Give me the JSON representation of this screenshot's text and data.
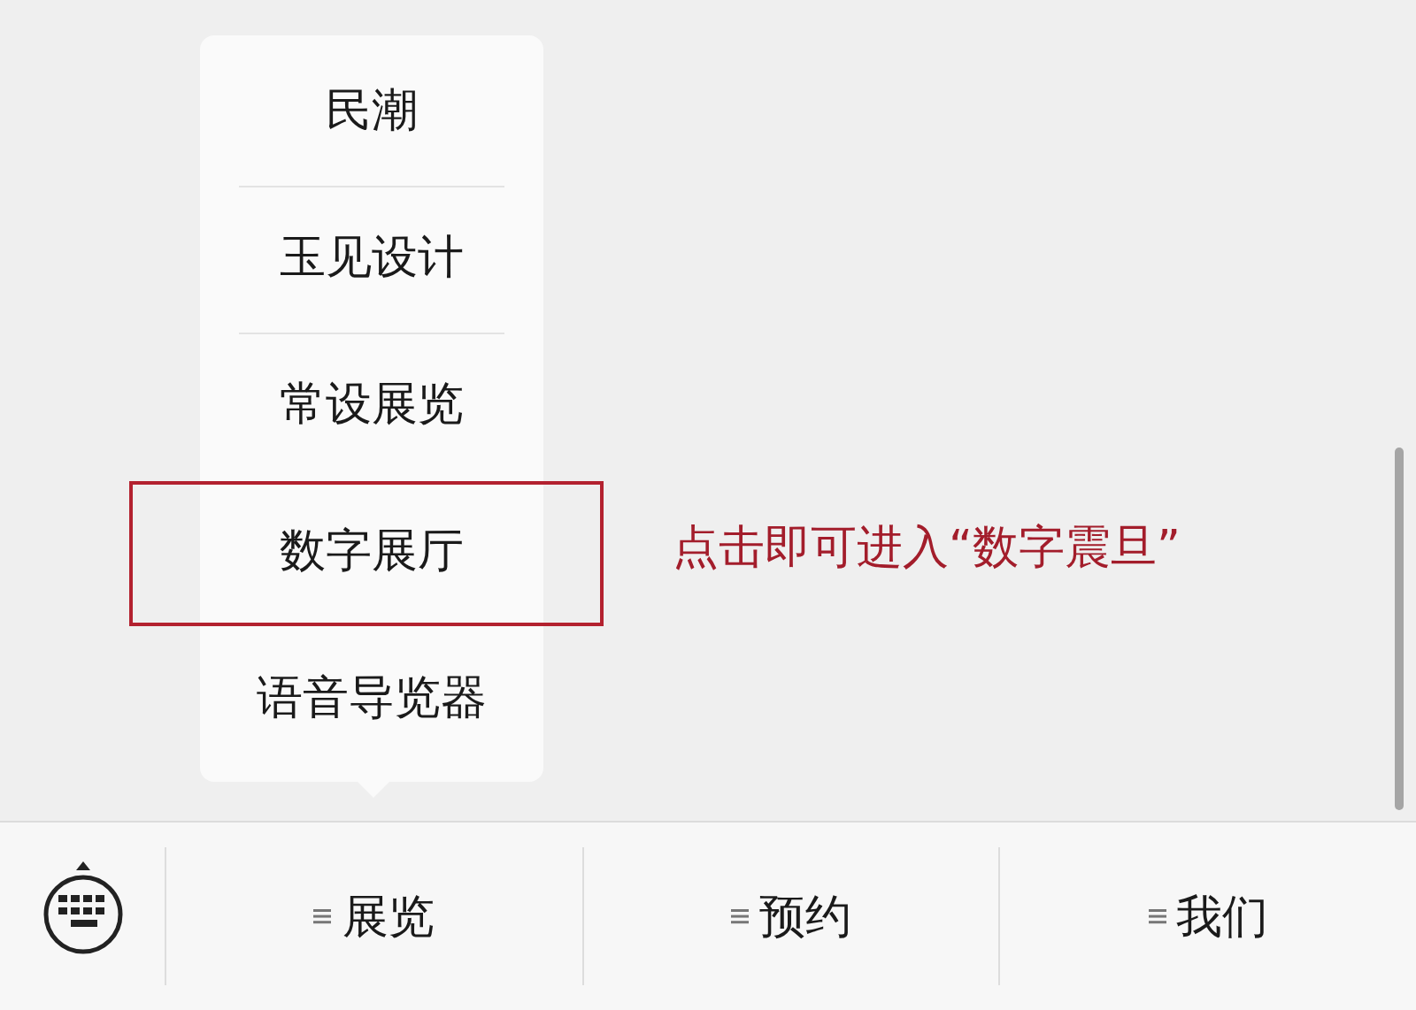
{
  "submenu": {
    "items": [
      {
        "label": "民潮",
        "selected": false
      },
      {
        "label": "玉见设计",
        "selected": false
      },
      {
        "label": "常设展览",
        "selected": false
      },
      {
        "label": "数字展厅",
        "selected": true
      },
      {
        "label": "语音导览器",
        "selected": false
      }
    ]
  },
  "annotation": "点击即可进入“数字震旦”",
  "bottom_menu": {
    "items": [
      {
        "label": "展览"
      },
      {
        "label": "预约"
      },
      {
        "label": "我们"
      }
    ]
  }
}
